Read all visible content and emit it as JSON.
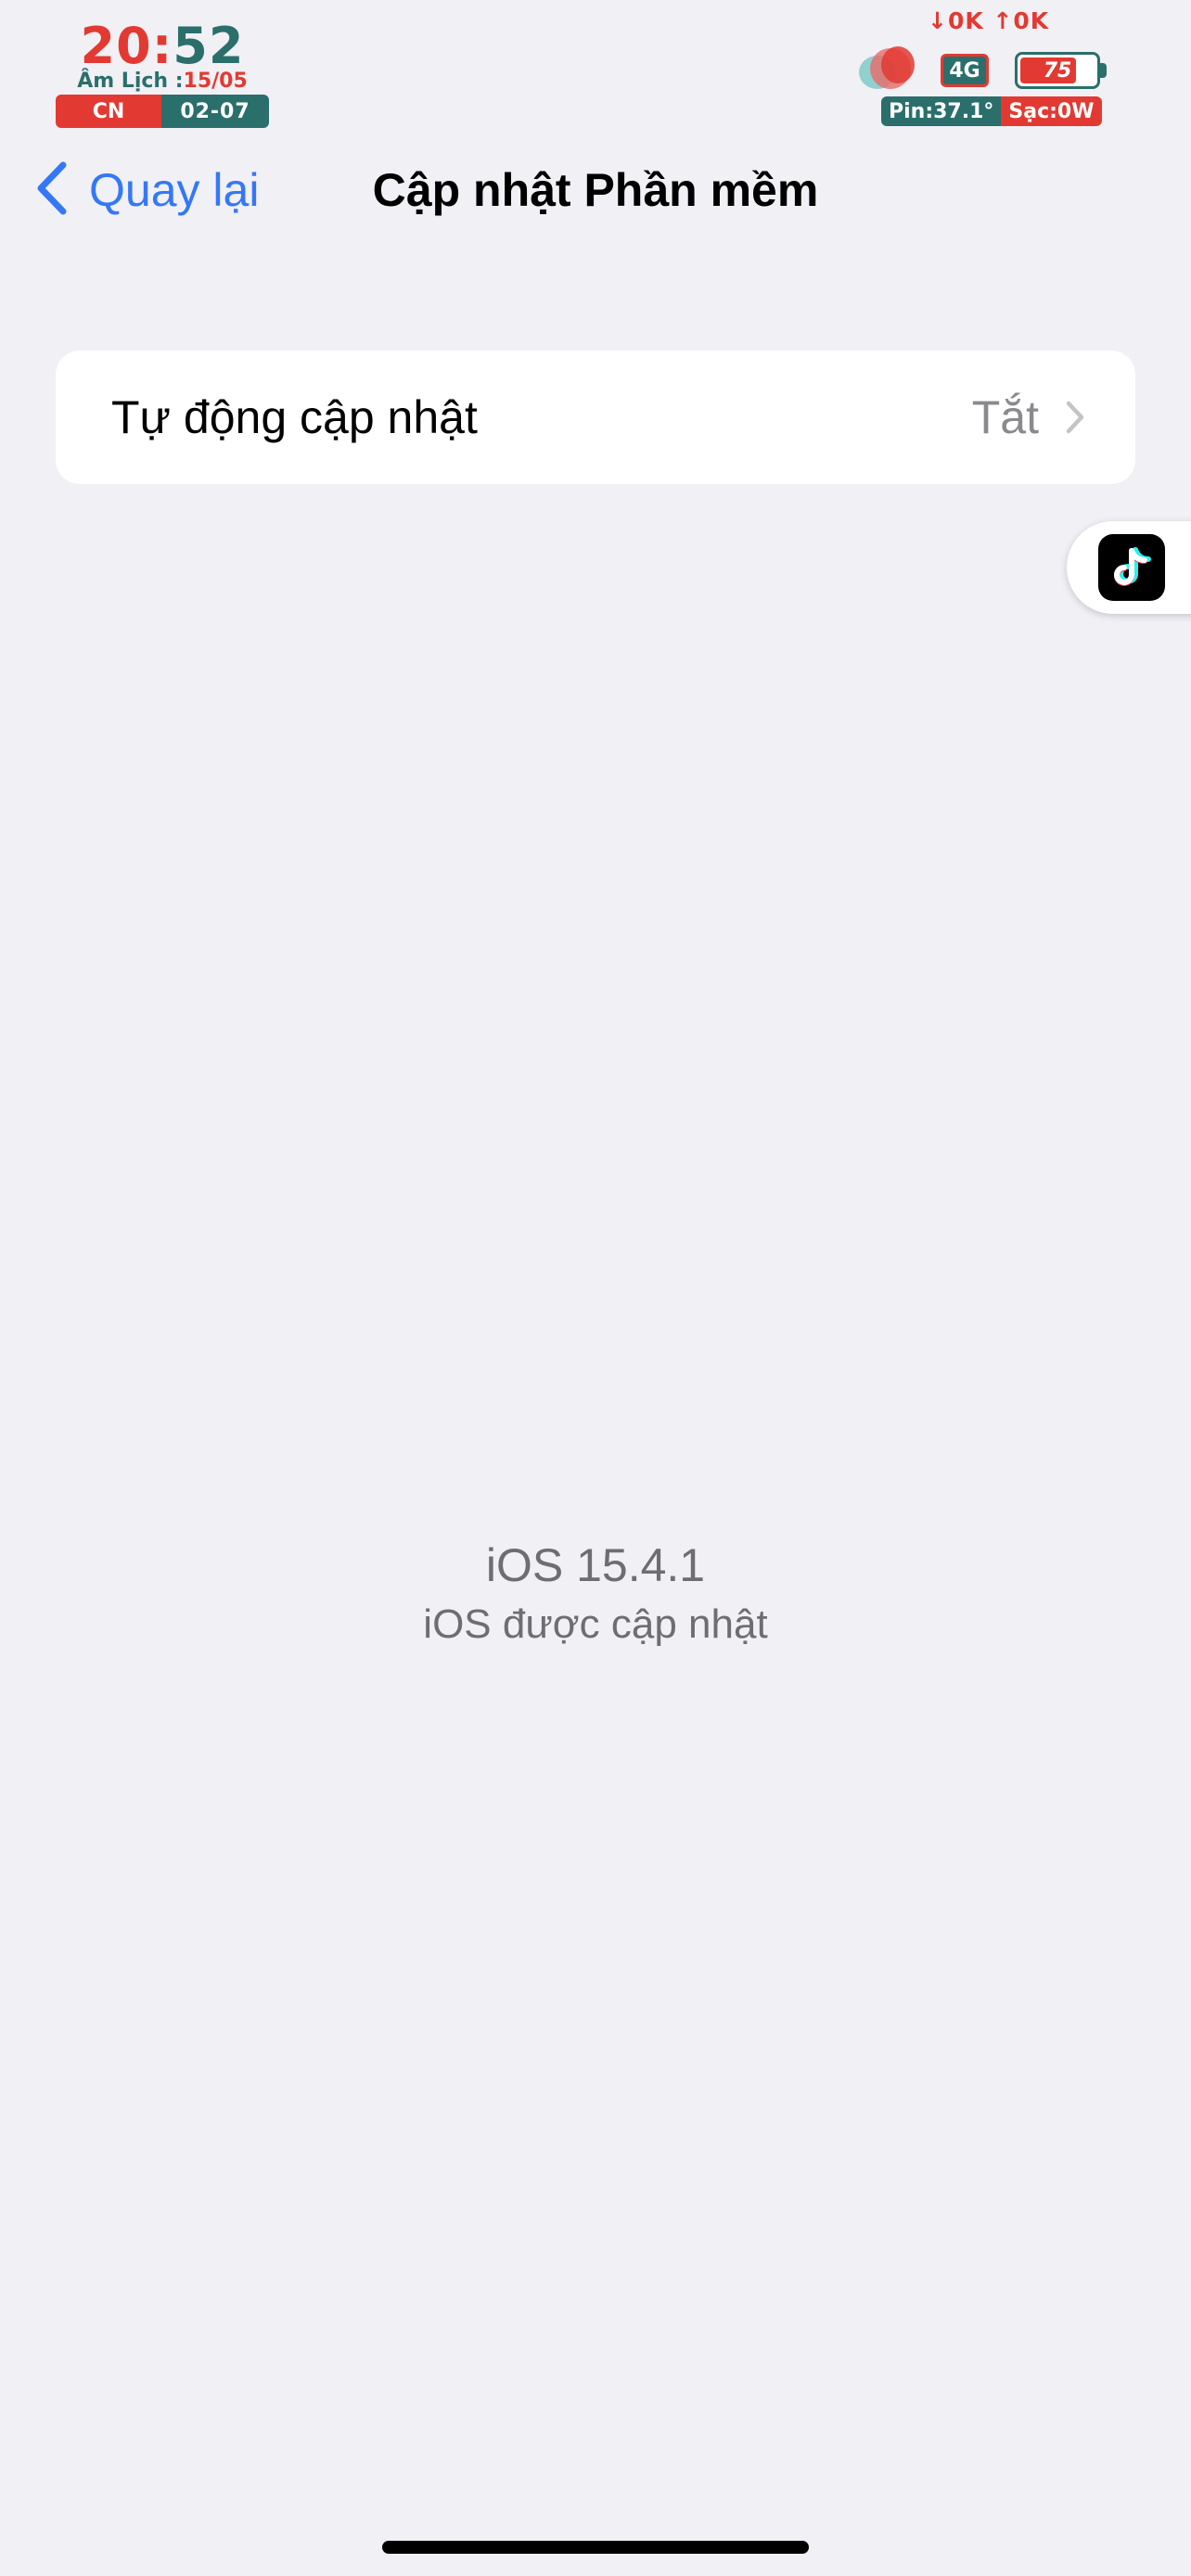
{
  "status_bar": {
    "clock_hour": "20",
    "clock_sep": ":",
    "clock_minute": "52",
    "lunar_label": "Âm Lịch :",
    "lunar_date": "15/05",
    "day_of_week": "CN",
    "date": "02-07",
    "net_speed": "↓0K ↑0K",
    "network": "4G",
    "battery": "75",
    "battery_level_percent": 75,
    "temperature": "Pin:37.1°",
    "charging": "Sạc:0W"
  },
  "nav": {
    "back_label": "Quay lại",
    "title": "Cập nhật Phần mềm"
  },
  "settings": {
    "auto_update_label": "Tự động cập nhật",
    "auto_update_value": "Tắt"
  },
  "version": {
    "number": "iOS 15.4.1",
    "status": "iOS được cập nhật"
  },
  "floating_app": {
    "icon": "tiktok-icon"
  },
  "colors": {
    "accent": "#3478f6",
    "background": "#f1f0f5",
    "widget_red": "#e23a32",
    "widget_teal": "#2a6f6b"
  }
}
